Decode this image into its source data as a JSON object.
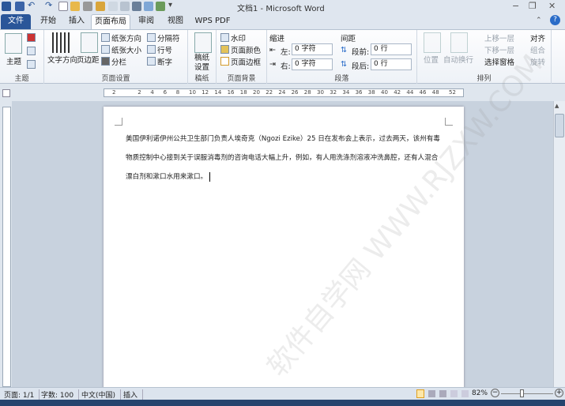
{
  "window": {
    "title": "文档1 - Microsoft Word",
    "minimize": "−",
    "restore": "❐",
    "close": "✕"
  },
  "tabs": [
    {
      "label": "文件"
    },
    {
      "label": "开始"
    },
    {
      "label": "插入"
    },
    {
      "label": "页面布局"
    },
    {
      "label": "审阅"
    },
    {
      "label": "视图"
    },
    {
      "label": "WPS PDF"
    }
  ],
  "ribbon": {
    "theme": {
      "label": "主题",
      "btn": "主题"
    },
    "page_setup": {
      "label": "页面设置",
      "text_dir": "文字方向",
      "margins": "页边距",
      "orientation": "纸张方向",
      "size": "纸张大小",
      "columns": "分栏",
      "breaks": "分隔符",
      "line_numbers": "行号",
      "hyphenation": "断字"
    },
    "draft": {
      "label": "稿纸",
      "btn": "稿纸\n设置"
    },
    "page_bg": {
      "label": "页面背景",
      "watermark": "水印",
      "page_color": "页面颜色",
      "page_border": "页面边框"
    },
    "paragraph": {
      "label": "段落",
      "indent": "缩进",
      "spacing": "间距",
      "left": "左:",
      "right": "右:",
      "before": "段前:",
      "after": "段后:",
      "left_val": "0 字符",
      "right_val": "0 字符",
      "before_val": "0 行",
      "after_val": "0 行"
    },
    "arrange": {
      "label": "排列",
      "position": "位置",
      "wrap": "自动换行",
      "bring_forward": "上移一层",
      "send_backward": "下移一层",
      "selection_pane": "选择窗格",
      "align": "对齐",
      "group": "组合",
      "rotate": "旋转"
    }
  },
  "ruler": {
    "labels": [
      "2",
      "2",
      "4",
      "6",
      "8",
      "10",
      "12",
      "14",
      "16",
      "18",
      "20",
      "22",
      "24",
      "26",
      "28",
      "30",
      "32",
      "34",
      "36",
      "38",
      "40",
      "42",
      "44",
      "46",
      "48",
      "52"
    ]
  },
  "document": {
    "lines": [
      "美国伊利诺伊州公共卫生部门负责人埃奇克（Ngozi Ezike）25 日在发布会上表示，过去两天，该州有毒",
      "物质控制中心接到关于误服消毒剂的咨询电话大幅上升，例如，有人用洗涤剂溶液冲洗鼻腔，还有人混合",
      "漂白剂和漱口水用来漱口。"
    ],
    "watermark": "软件自学网 WWW.RJZXW.COM"
  },
  "status": {
    "page": "页面: 1/1",
    "words": "字数: 100",
    "lang": "中文(中国)",
    "mode": "插入",
    "zoom": "82%"
  }
}
